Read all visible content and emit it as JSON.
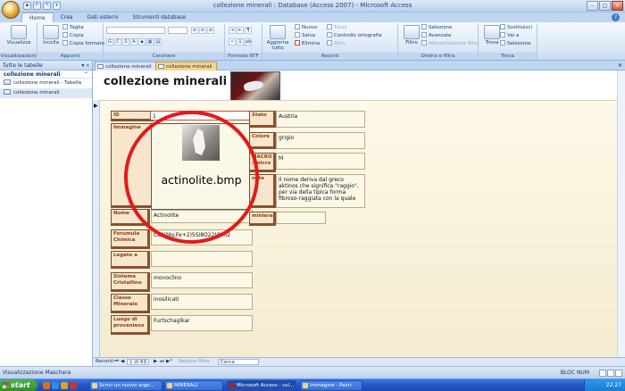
{
  "window": {
    "title": "collezione minerali : Database (Access 2007) - Microsoft Access",
    "min": "–",
    "max": "□",
    "close": "✕",
    "help": "?"
  },
  "ribbon_tabs": [
    "Home",
    "Crea",
    "Dati esterni",
    "Strumenti database"
  ],
  "ribbon": {
    "views": {
      "group": "Visualizzazioni",
      "btn": "Visualizza"
    },
    "clipboard": {
      "group": "Appunti",
      "paste": "Incolla",
      "cut": "Taglia",
      "copy": "Copia",
      "format": "Copia formato"
    },
    "font": {
      "group": "Carattere"
    },
    "rtf": {
      "group": "Formato RTF"
    },
    "records": {
      "group": "Record",
      "refresh": "Aggiorna tutto",
      "new": "Nuovo",
      "save": "Salva",
      "delete": "Elimina",
      "totals": "Totali",
      "spell": "Controllo ortografia",
      "more": "Altro"
    },
    "sort": {
      "group": "Ordina e filtra",
      "filter": "Filtro",
      "selection": "Selezione",
      "advanced": "Avanzate",
      "toggle": "Attiva/disattiva filtro"
    },
    "find": {
      "group": "Trova",
      "find": "Trova",
      "replace": "Sostituisci",
      "goto": "Vai a",
      "select": "Seleziona"
    }
  },
  "nav_pane": {
    "header": "Tutte le tabelle",
    "group": "collezione minerali",
    "items": [
      "collezione minerali : Tabella",
      "collezione minerali"
    ]
  },
  "doc_tabs": [
    "collezione minerali",
    "collezione minerali"
  ],
  "form": {
    "title": "collezione minerali",
    "fields": {
      "id": {
        "label": "ID",
        "value": "1"
      },
      "immagine": {
        "label": "Immagine",
        "caption": "actinolite.bmp"
      },
      "nome": {
        "label": "Nome",
        "value": "Actinolite"
      },
      "formula": {
        "label": "Forumula Chimica",
        "value": "Ca2(Mg,Fe+2)5Si8O22(OH)2"
      },
      "legato": {
        "label": "Legato a",
        "value": ""
      },
      "sistema": {
        "label": "Sistema Cristallino",
        "value": "monoclino"
      },
      "classe": {
        "label": "Classe Minerale",
        "value": "inosilicati"
      },
      "luogo": {
        "label": "Luogo di provenienz",
        "value": "Furtschaglkar"
      },
      "stato": {
        "label": "Stato",
        "value": "Austria"
      },
      "colore": {
        "label": "Colore",
        "value": "grigio"
      },
      "macro": {
        "label": "MACRO / micro",
        "value": "M"
      },
      "note": {
        "label": "note",
        "value": "Il nome deriva dal greco aktinos che significa \"raggio\", per via della tipica forma fibroso-raggiata con la quale"
      },
      "miniera": {
        "label": "miniera",
        "value": ""
      }
    }
  },
  "record_nav": {
    "label": "Record:",
    "position": "1 di 69",
    "filter": "Nessun filtro",
    "search": "Cerca"
  },
  "status": {
    "left": "Visualizzazione Maschera",
    "right": "BLOC NUM"
  },
  "taskbar": {
    "start": "start",
    "tasks": [
      "Scrivi un nuovo argo...",
      "MINERALI",
      "Microsoft Access - col...",
      "Immagine - Paint"
    ],
    "clock": "22.27"
  },
  "colors": {
    "annotation": "#e31b1b",
    "label_text": "#8b3a10",
    "active_tab": "#f7d48a"
  }
}
